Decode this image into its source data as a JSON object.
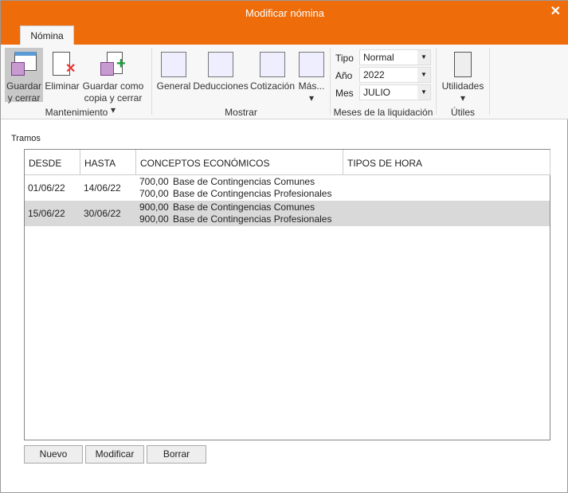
{
  "window": {
    "title": "Modificar nómina",
    "close": "✕"
  },
  "ribbon": {
    "tab": "Nómina",
    "buttons": {
      "guardar": "Guardar y cerrar",
      "eliminar": "Eliminar",
      "guardar_copia": "Guardar como copia y cerrar",
      "general": "General",
      "deducciones": "Deducciones",
      "cotizacion": "Cotización",
      "mas": "Más...",
      "utilidades": "Utilidades"
    },
    "groups": {
      "mantenimiento": "Mantenimiento",
      "mostrar": "Mostrar",
      "meses": "Meses de la liquidación",
      "utiles": "Útiles"
    },
    "fields": {
      "tipo_label": "Tipo",
      "tipo": "Normal",
      "anio_label": "Año",
      "anio": "2022",
      "mes_label": "Mes",
      "mes": "JULIO"
    }
  },
  "tramos": {
    "label": "Tramos",
    "headers": [
      "DESDE",
      "HASTA",
      "CONCEPTOS ECONÓMICOS",
      "TIPOS DE HORA"
    ],
    "rows": [
      {
        "desde": "01/06/22",
        "hasta": "14/06/22",
        "c1v": "700,00",
        "c1": "Base de Contingencias Comunes",
        "c2v": "700,00",
        "c2": "Base de Contingencias Profesionales"
      },
      {
        "desde": "15/06/22",
        "hasta": "30/06/22",
        "c1v": "900,00",
        "c1": "Base de Contingencias Comunes",
        "c2v": "900,00",
        "c2": "Base de Contingencias Profesionales"
      }
    ]
  },
  "actions": {
    "nuevo": "Nuevo",
    "modificar": "Modificar",
    "borrar": "Borrar"
  }
}
